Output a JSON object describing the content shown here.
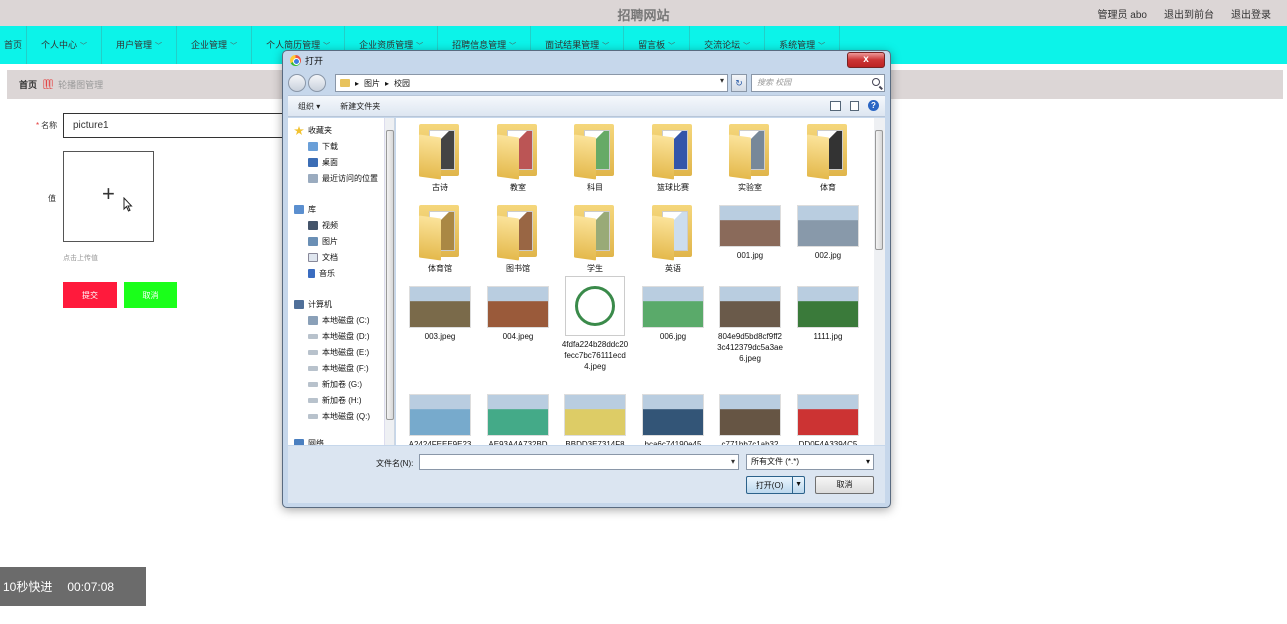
{
  "header": {
    "site_title": "招聘网站",
    "links": [
      "管理员 abo",
      "退出到前台",
      "退出登录"
    ]
  },
  "nav": {
    "items": [
      {
        "label": "首页",
        "has_dropdown": false
      },
      {
        "label": "个人中心",
        "has_dropdown": true
      },
      {
        "label": "用户管理",
        "has_dropdown": true
      },
      {
        "label": "企业管理",
        "has_dropdown": true
      },
      {
        "label": "个人简历管理",
        "has_dropdown": true
      },
      {
        "label": "企业资质管理",
        "has_dropdown": true
      },
      {
        "label": "招聘信息管理",
        "has_dropdown": true
      },
      {
        "label": "面试结果管理",
        "has_dropdown": true
      },
      {
        "label": "留言板",
        "has_dropdown": true
      },
      {
        "label": "交流论坛",
        "has_dropdown": true
      },
      {
        "label": "系统管理",
        "has_dropdown": true
      }
    ],
    "dropdown_glyph": "﹀"
  },
  "breadcrumb": {
    "home": "首页",
    "separator": "ᥫᥫᥫ",
    "current": "轮播图管理"
  },
  "form": {
    "name_label": "名称",
    "name_required_mark": "*",
    "name_value": "picture1",
    "image_label": "值",
    "upload_plus": "+",
    "upload_hint": "点击上传值",
    "submit_label": "提交",
    "cancel_label": "取消"
  },
  "video_overlay": {
    "skip_label": "10秒快进",
    "time": "00:07:08"
  },
  "dialog": {
    "title": "打开",
    "close_glyph": "x",
    "path": [
      "图片",
      "校园"
    ],
    "search_placeholder": "搜索 校园",
    "toolbar": {
      "organize": "组织 ▾",
      "new_folder": "新建文件夹"
    },
    "nav_tree": [
      {
        "label": "收藏夹",
        "icon": "star-icon",
        "level": 0
      },
      {
        "label": "下载",
        "icon": "download-icon",
        "level": 1
      },
      {
        "label": "桌面",
        "icon": "desktop-icon",
        "level": 1
      },
      {
        "label": "最近访问的位置",
        "icon": "recent-icon",
        "level": 1
      },
      {
        "label": "库",
        "icon": "library-icon",
        "level": 0
      },
      {
        "label": "视频",
        "icon": "video-icon",
        "level": 1
      },
      {
        "label": "图片",
        "icon": "pictures-icon",
        "level": 1
      },
      {
        "label": "文档",
        "icon": "documents-icon",
        "level": 1
      },
      {
        "label": "音乐",
        "icon": "music-icon",
        "level": 1
      },
      {
        "label": "计算机",
        "icon": "computer-icon",
        "level": 0
      },
      {
        "label": "本地磁盘 (C:)",
        "icon": "drive-c-icon",
        "level": 1
      },
      {
        "label": "本地磁盘 (D:)",
        "icon": "drive-icon",
        "level": 1
      },
      {
        "label": "本地磁盘 (E:)",
        "icon": "drive-icon",
        "level": 1
      },
      {
        "label": "本地磁盘 (F:)",
        "icon": "drive-icon",
        "level": 1
      },
      {
        "label": "新加卷 (G:)",
        "icon": "drive-icon",
        "level": 1
      },
      {
        "label": "新加卷 (H:)",
        "icon": "drive-icon",
        "level": 1
      },
      {
        "label": "本地磁盘 (Q:)",
        "icon": "drive-icon",
        "level": 1
      },
      {
        "label": "网络",
        "icon": "network-icon",
        "level": 0
      }
    ],
    "files": [
      {
        "name": "古诗",
        "kind": "folder",
        "color": "#444"
      },
      {
        "name": "教室",
        "kind": "folder",
        "color": "#b55"
      },
      {
        "name": "科目",
        "kind": "folder",
        "color": "#6a6"
      },
      {
        "name": "篮球比赛",
        "kind": "folder",
        "color": "#35a"
      },
      {
        "name": "实验室",
        "kind": "folder",
        "color": "#789"
      },
      {
        "name": "体育",
        "kind": "folder",
        "color": "#333"
      },
      {
        "name": "体育馆",
        "kind": "folder",
        "color": "#a84"
      },
      {
        "name": "图书馆",
        "kind": "folder",
        "color": "#964"
      },
      {
        "name": "学生",
        "kind": "folder",
        "color": "#9a7"
      },
      {
        "name": "英语",
        "kind": "folder",
        "color": "#cde"
      },
      {
        "name": "001.jpg",
        "kind": "image",
        "color": "#8a6a5a"
      },
      {
        "name": "002.jpg",
        "kind": "image",
        "color": "#8899aa"
      },
      {
        "name": "003.jpeg",
        "kind": "image",
        "color": "#7a6a4a"
      },
      {
        "name": "004.jpeg",
        "kind": "image",
        "color": "#9a5a3a"
      },
      {
        "name": "4fdfa224b28ddc20fecc7bc76111ecd4.jpeg",
        "kind": "image",
        "color": "#3a8a4a"
      },
      {
        "name": "006.jpg",
        "kind": "image",
        "color": "#5aaa6a"
      },
      {
        "name": "804e9d5bd8cf9ff23c412379dc5a3ae6.jpeg",
        "kind": "image",
        "color": "#6a5a4a"
      },
      {
        "name": "1111.jpg",
        "kind": "image",
        "color": "#3a7a3a"
      },
      {
        "name": "A2424FEEE9E23",
        "kind": "image",
        "color": "#7ac"
      },
      {
        "name": "AE93A4A732BD",
        "kind": "image",
        "color": "#4a8"
      },
      {
        "name": "BBDD3E7314F8",
        "kind": "image",
        "color": "#dc6"
      },
      {
        "name": "bca6c74190e45",
        "kind": "image",
        "color": "#357"
      },
      {
        "name": "c771bb7c1ab32",
        "kind": "image",
        "color": "#654"
      },
      {
        "name": "DD0F4A3394C5",
        "kind": "image",
        "color": "#c33"
      }
    ],
    "filename_label": "文件名(N):",
    "filename_value": "",
    "filter_value": "所有文件 (*.*)",
    "open_label": "打开(O)",
    "cancel_label": "取消"
  },
  "colors": {
    "nav_bg": "#0cf3e9",
    "submit_bg": "#ff1a3c",
    "cancel_bg": "#1aff1a"
  }
}
